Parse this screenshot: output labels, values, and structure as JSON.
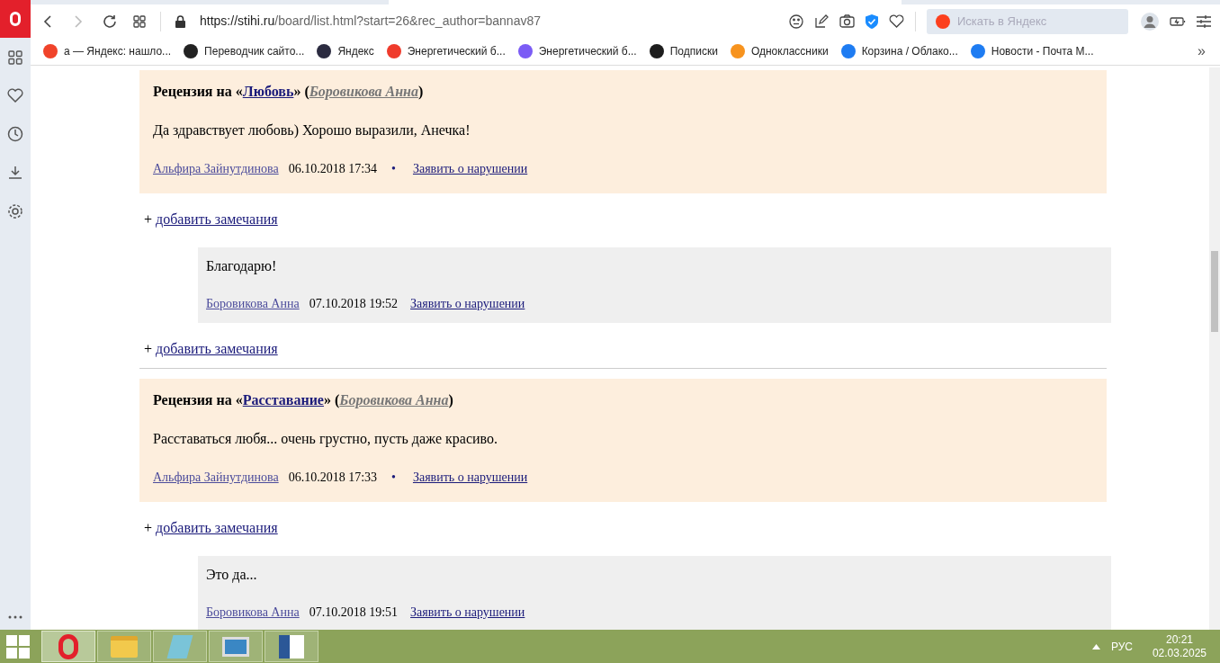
{
  "browser": {
    "url_host": "https://stihi.ru",
    "url_path": "/board/list.html?start=26&rec_author=bannav87",
    "search_placeholder": "Искать в Яндекс",
    "bookmarks": [
      {
        "label": "а — Яндекс: нашло...",
        "color": "#f0432a"
      },
      {
        "label": "Переводчик сайто...",
        "color": "#222222"
      },
      {
        "label": "Яндекс",
        "color": "#2b2b40"
      },
      {
        "label": "Энергетический б...",
        "color": "#ef3b2c"
      },
      {
        "label": "Энергетический б...",
        "color": "#7b5cf5"
      },
      {
        "label": "Подписки",
        "color": "#1d1d1d"
      },
      {
        "label": "Одноклассники",
        "color": "#f7931e"
      },
      {
        "label": "Корзина / Облако...",
        "color": "#1e7cf2"
      },
      {
        "label": "Новости - Почта М...",
        "color": "#1e7cf2"
      }
    ],
    "more": "»"
  },
  "feed": [
    {
      "kind": "review",
      "prefix": "Рецензия на «",
      "work": "Любовь",
      "mid": "» (",
      "author": "Боровикова Анна",
      "suffix": ")",
      "text": "Да здравствует любовь) Хорошо выразили, Анечка!",
      "reviewer": "Альфира Зайнутдинова",
      "date": "06.10.2018 17:34",
      "bullet": "•",
      "report": "Заявить о нарушении"
    },
    {
      "kind": "add",
      "plus": "+",
      "label": "добавить замечания"
    },
    {
      "kind": "reply",
      "text": "Благодарю!",
      "reviewer": "Боровикова Анна",
      "date": "07.10.2018 19:52",
      "report": "Заявить о нарушении"
    },
    {
      "kind": "add",
      "plus": "+",
      "label": "добавить замечания"
    },
    {
      "kind": "divider"
    },
    {
      "kind": "review",
      "prefix": "Рецензия на «",
      "work": "Расставание",
      "mid": "» (",
      "author": "Боровикова Анна",
      "suffix": ")",
      "text": "Расставаться любя... очень грустно, пусть даже красиво.",
      "reviewer": "Альфира Зайнутдинова",
      "date": "06.10.2018 17:33",
      "bullet": "•",
      "report": "Заявить о нарушении"
    },
    {
      "kind": "add",
      "plus": "+",
      "label": "добавить замечания"
    },
    {
      "kind": "reply",
      "text": "Это да...",
      "reviewer": "Боровикова Анна",
      "date": "07.10.2018 19:51",
      "report": "Заявить о нарушении"
    }
  ],
  "taskbar": {
    "language": "РУС",
    "time": "20:21",
    "date": "02.03.2025"
  }
}
